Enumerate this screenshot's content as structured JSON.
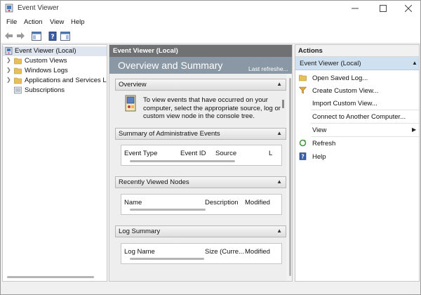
{
  "window": {
    "title": "Event Viewer"
  },
  "menu": {
    "items": [
      "File",
      "Action",
      "View",
      "Help"
    ]
  },
  "tree": {
    "root": "Event Viewer (Local)",
    "items": [
      "Custom Views",
      "Windows Logs",
      "Applications and Services Log",
      "Subscriptions"
    ]
  },
  "center": {
    "header": "Event Viewer (Local)",
    "banner_title": "Overview and Summary",
    "banner_right": "Last refreshe...",
    "overview": {
      "heading": "Overview",
      "text": "To view events that have occurred on your computer, select the appropriate source, log or custom view node in the console tree."
    },
    "admin_events": {
      "heading": "Summary of Administrative Events",
      "columns": [
        "Event Type",
        "Event ID",
        "Source",
        "L"
      ]
    },
    "recent_nodes": {
      "heading": "Recently Viewed Nodes",
      "columns": [
        "Name",
        "Description",
        "Modified"
      ]
    },
    "log_summary": {
      "heading": "Log Summary",
      "columns": [
        "Log Name",
        "Size (Curre...",
        "Modified"
      ]
    }
  },
  "actions": {
    "header": "Actions",
    "section": "Event Viewer (Local)",
    "items": [
      {
        "label": "Open Saved Log...",
        "icon": "folder-icon"
      },
      {
        "label": "Create Custom View...",
        "icon": "filter-icon"
      },
      {
        "label": "Import Custom View...",
        "icon": ""
      },
      {
        "label": "Connect to Another Computer...",
        "icon": ""
      },
      {
        "label": "View",
        "icon": ""
      },
      {
        "label": "Refresh",
        "icon": "refresh-icon"
      },
      {
        "label": "Help",
        "icon": "help-icon"
      }
    ]
  },
  "colors": {
    "accent": "#cfe0f1",
    "header_dark": "#6f7173",
    "banner": "#8a97a4"
  }
}
